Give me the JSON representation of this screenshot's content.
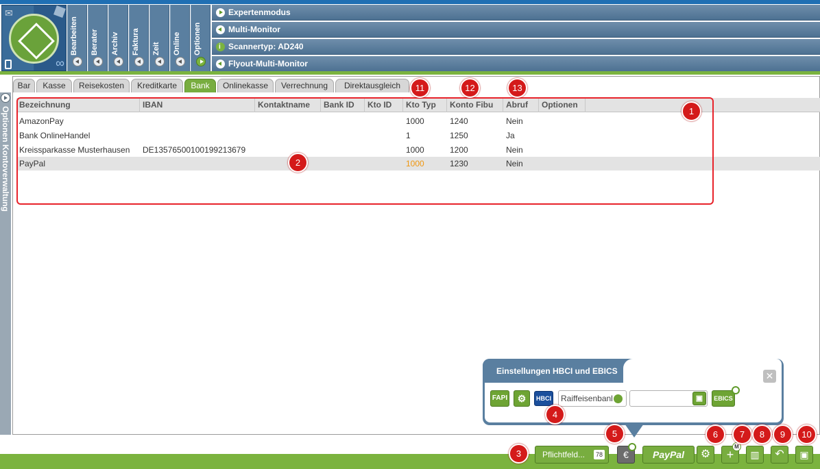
{
  "menu": {
    "items": [
      {
        "label": "Bearbeiten"
      },
      {
        "label": "Berater"
      },
      {
        "label": "Archiv"
      },
      {
        "label": "Faktura"
      },
      {
        "label": "Zeit"
      },
      {
        "label": "Online"
      },
      {
        "label": "Optionen"
      }
    ]
  },
  "options_panel": {
    "rows": [
      {
        "label": "Expertenmodus",
        "icon": "play-icon"
      },
      {
        "label": "Multi-Monitor",
        "icon": "back-icon"
      },
      {
        "label": "Scannertyp: AD240",
        "icon": "info-icon"
      },
      {
        "label": "Flyout-Multi-Monitor",
        "icon": "back-icon"
      }
    ]
  },
  "sidebar": {
    "label": "Optionen   Kontoverwaltung"
  },
  "tabs": [
    "Bar",
    "Kasse",
    "Reisekosten",
    "Kreditkarte",
    "Bank",
    "Onlinekasse",
    "Verrechnung",
    "Direktausgleich"
  ],
  "active_tab": "Bank",
  "table": {
    "columns": [
      "Bezeichnung",
      "IBAN",
      "Kontaktname",
      "Bank ID",
      "Kto ID",
      "Kto Typ",
      "Konto Fibu",
      "Abruf",
      "Optionen"
    ],
    "rows": [
      {
        "bezeichnung": "AmazonPay",
        "iban": "",
        "kontaktname": "",
        "bank_id": "",
        "kto_id": "",
        "kto_typ": "1000",
        "konto_fibu": "1240",
        "abruf": "Nein",
        "optionen": ""
      },
      {
        "bezeichnung": "Bank OnlineHandel",
        "iban": "",
        "kontaktname": "",
        "bank_id": "",
        "kto_id": "",
        "kto_typ": "1",
        "konto_fibu": "1250",
        "abruf": "Ja",
        "optionen": ""
      },
      {
        "bezeichnung": "Kreissparkasse Musterhausen",
        "iban": "DE13576500100199213679",
        "kontaktname": "",
        "bank_id": "",
        "kto_id": "",
        "kto_typ": "1000",
        "konto_fibu": "1200",
        "abruf": "Nein",
        "optionen": ""
      },
      {
        "bezeichnung": "PayPal",
        "iban": "",
        "kontaktname": "",
        "bank_id": "",
        "kto_id": "",
        "kto_typ": "1000",
        "konto_fibu": "1230",
        "abruf": "Nein",
        "optionen": ""
      }
    ]
  },
  "hbci_panel": {
    "title": "Einstellungen HBCI und EBICS",
    "close": "✕",
    "fapi_label": "FAPI",
    "hbci_label": "HBCI",
    "bank_value": "Raiffeisenbanl",
    "second_value": "",
    "ebics_label": "EBICS"
  },
  "bottom_bar": {
    "pflichtfeld_label": "Pflichtfeld...",
    "paypal_label": "PayPal",
    "euro_label": "€",
    "m_badge": "M"
  },
  "markers": [
    "1",
    "2",
    "3",
    "4",
    "5",
    "6",
    "7",
    "8",
    "9",
    "10",
    "11",
    "12",
    "13"
  ],
  "colors": {
    "accent_green": "#7bb33f",
    "header_blue": "#5a7fa0",
    "marker_red": "#d41a1a",
    "highlight_orange": "#f0960e"
  }
}
